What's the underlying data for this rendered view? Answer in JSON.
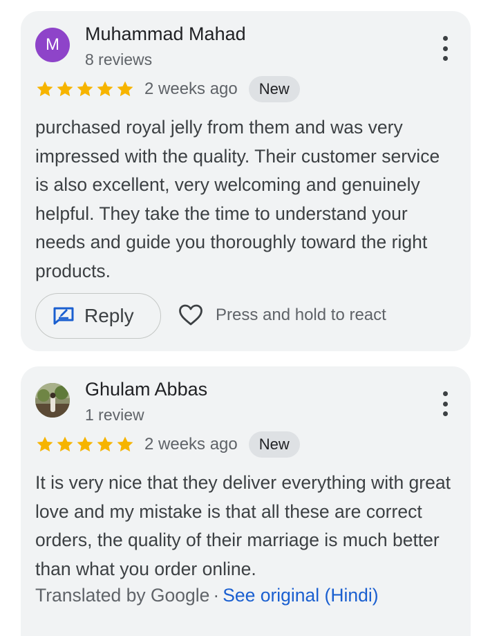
{
  "colors": {
    "star": "#f6b400",
    "link": "#1a5fd0",
    "avatar_bg": "#8e44c9",
    "card_bg": "#f1f3f4"
  },
  "reviews": [
    {
      "avatar_letter": "M",
      "name": "Muhammad Mahad",
      "review_count": "8 reviews",
      "rating": 5,
      "time": "2 weeks ago",
      "badge": "New",
      "text": "purchased royal jelly from them and was very impressed with the quality. Their customer service is also excellent, very welcoming and genuinely helpful. They take the time to understand your needs and guide you thoroughly toward the right products.",
      "reply_label": "Reply",
      "react_label": "Press and hold to react"
    },
    {
      "avatar_icon": "profile-photo",
      "name": "Ghulam Abbas",
      "review_count": "1 review",
      "rating": 5,
      "time": "2 weeks ago",
      "badge": "New",
      "text": "It is very nice that they deliver everything with great love and my mistake is that all these are correct orders, the quality of their marriage is much better than what you order online.",
      "translated_label": "Translated by Google",
      "separator": "·",
      "see_original": "See original (Hindi)"
    }
  ]
}
